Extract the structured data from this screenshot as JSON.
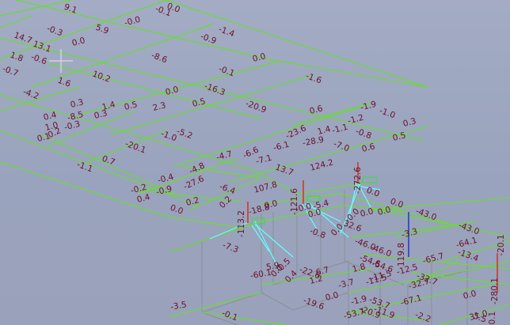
{
  "colors": {
    "background": "#9fa8c0",
    "member": "#66dd33",
    "support": "#66ffff",
    "wall": "#8a8f98",
    "label": "#6b0f2a",
    "axis_blue": "#2233cc",
    "axis_red": "#cc3322",
    "node_mark": "#33dd44"
  },
  "labels": [
    {
      "text": "9.1"
    },
    {
      "text": "-0.1"
    },
    {
      "text": "0.0"
    },
    {
      "text": "-0.0"
    },
    {
      "text": "-1.4"
    },
    {
      "text": "-0.3"
    },
    {
      "text": "5.9"
    },
    {
      "text": "-0.9"
    },
    {
      "text": "14.7"
    },
    {
      "text": "13.1"
    },
    {
      "text": "0.0"
    },
    {
      "text": "1.8"
    },
    {
      "text": "-0.6"
    },
    {
      "text": "-8.6"
    },
    {
      "text": "0.0"
    },
    {
      "text": "-0.7"
    },
    {
      "text": "10.2"
    },
    {
      "text": "-0.1"
    },
    {
      "text": "-1.6"
    },
    {
      "text": "1.6"
    },
    {
      "text": "-16.3"
    },
    {
      "text": "-4.2"
    },
    {
      "text": "0.3"
    },
    {
      "text": "1.4"
    },
    {
      "text": "0.5"
    },
    {
      "text": "2.3"
    },
    {
      "text": "0.0"
    },
    {
      "text": "0.5"
    },
    {
      "text": "-20.9"
    },
    {
      "text": "0.6"
    },
    {
      "text": "-1.9"
    },
    {
      "text": "-1.0"
    },
    {
      "text": "0.3"
    },
    {
      "text": "0.4"
    },
    {
      "text": "-8.5"
    },
    {
      "text": "0.3"
    },
    {
      "text": "-1.2"
    },
    {
      "text": "1.0"
    },
    {
      "text": "-0.3"
    },
    {
      "text": "-5.2"
    },
    {
      "text": "-23.6"
    },
    {
      "text": "1.4"
    },
    {
      "text": "-1.1"
    },
    {
      "text": "-0.8"
    },
    {
      "text": "0.5"
    },
    {
      "text": "0.1"
    },
    {
      "text": "0.2"
    },
    {
      "text": "-28.9"
    },
    {
      "text": "-7.0"
    },
    {
      "text": "0.6"
    },
    {
      "text": "-20.1"
    },
    {
      "text": "-1.0"
    },
    {
      "text": "-6.1"
    },
    {
      "text": "0.7"
    },
    {
      "text": "-4.7"
    },
    {
      "text": "-6.6"
    },
    {
      "text": "-7.1"
    },
    {
      "text": "13.7"
    },
    {
      "text": "124.2"
    },
    {
      "text": "-1.1"
    },
    {
      "text": "-4.8"
    },
    {
      "text": "-0.4"
    },
    {
      "text": "-27.6"
    },
    {
      "text": "-0.2"
    },
    {
      "text": "-0.9"
    },
    {
      "text": "-6.4"
    },
    {
      "text": "107.8"
    },
    {
      "text": "-121.6"
    },
    {
      "text": "-272.6"
    },
    {
      "text": "0.4"
    },
    {
      "text": "0.2"
    },
    {
      "text": "0.2"
    },
    {
      "text": "-113.2"
    },
    {
      "text": "0.0"
    },
    {
      "text": "-5.4"
    },
    {
      "text": "-0.0"
    },
    {
      "text": "0.0"
    },
    {
      "text": "0.0"
    },
    {
      "text": "0.0"
    },
    {
      "text": "-18.8"
    },
    {
      "text": "0.0"
    },
    {
      "text": "-0.0"
    },
    {
      "text": "0.0"
    },
    {
      "text": "-43.0"
    },
    {
      "text": "0.0"
    },
    {
      "text": "32.6"
    },
    {
      "text": "0.0"
    },
    {
      "text": "-0.8"
    },
    {
      "text": "-43.0"
    },
    {
      "text": "-3.3"
    },
    {
      "text": "-46.0"
    },
    {
      "text": "119.8"
    },
    {
      "text": "-64.1"
    },
    {
      "text": "-7.3"
    },
    {
      "text": "-46.0"
    },
    {
      "text": "-65.7"
    },
    {
      "text": "-13.4"
    },
    {
      "text": "-54.6"
    },
    {
      "text": "-20.1"
    },
    {
      "text": "1.8"
    },
    {
      "text": "-54.6"
    },
    {
      "text": "-11.5"
    },
    {
      "text": "-60.1"
    },
    {
      "text": "6.7"
    },
    {
      "text": "-12.5"
    },
    {
      "text": "-280.1"
    },
    {
      "text": "-22.6"
    },
    {
      "text": "-32.7"
    },
    {
      "text": "1.2"
    },
    {
      "text": "-3.7"
    },
    {
      "text": "-32.7"
    },
    {
      "text": "-11.5"
    },
    {
      "text": "0.0"
    },
    {
      "text": "-19.6"
    },
    {
      "text": "0.0"
    },
    {
      "text": "-1.9"
    },
    {
      "text": "-67.1"
    },
    {
      "text": "-53.7"
    },
    {
      "text": "-20.9"
    },
    {
      "text": "31.0"
    },
    {
      "text": "-0.1"
    },
    {
      "text": "-53.7"
    },
    {
      "text": "-11.9"
    },
    {
      "text": "-2.2"
    },
    {
      "text": "5.5"
    },
    {
      "text": "-0.1"
    },
    {
      "text": "5.9"
    },
    {
      "text": "-0.5"
    },
    {
      "text": "0.4"
    },
    {
      "text": "0.0"
    },
    {
      "text": "-3.5"
    }
  ]
}
